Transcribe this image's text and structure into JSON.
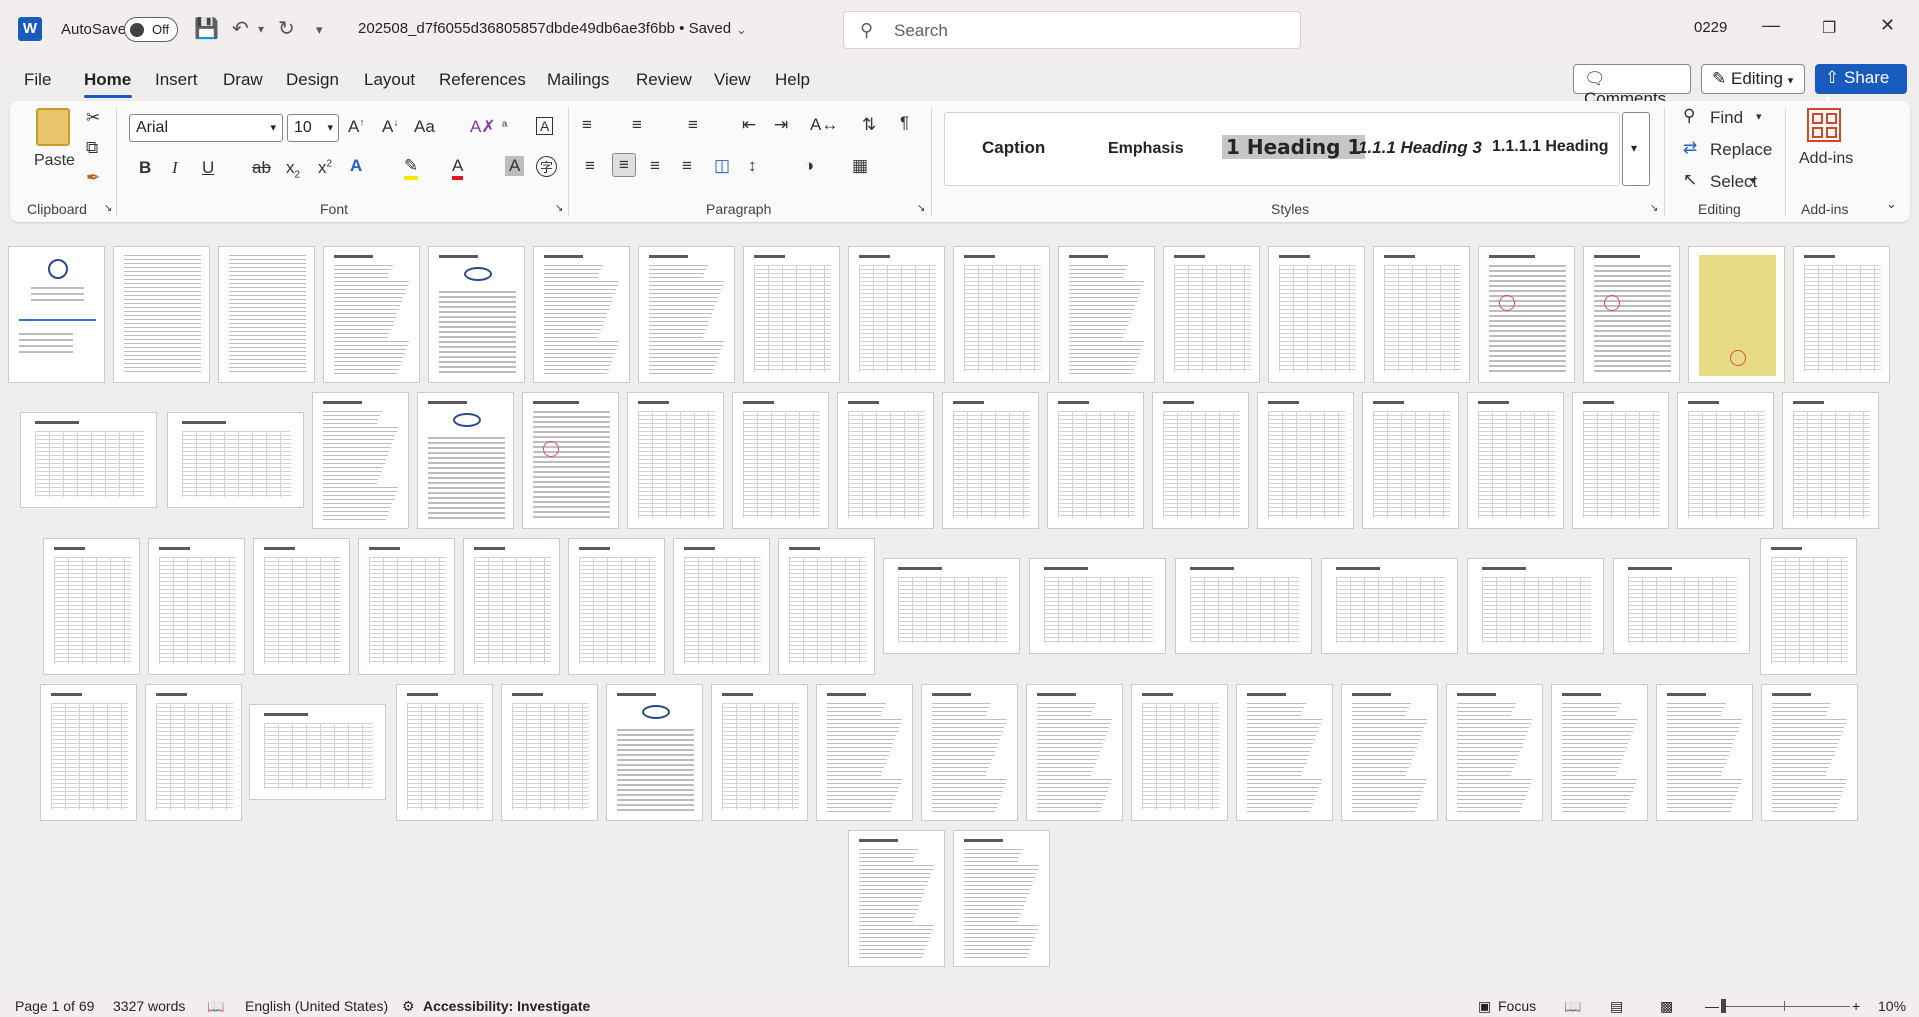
{
  "titlebar": {
    "app_icon": "word-icon",
    "autosave_label": "AutoSave",
    "autosave_state": "Off",
    "doc_title": "202508_d7f6055d36805857dbde49db6ae3f6bb • Saved",
    "search_placeholder": "Search",
    "user_id": "0229"
  },
  "tabs": [
    "File",
    "Home",
    "Insert",
    "Draw",
    "Design",
    "Layout",
    "References",
    "Mailings",
    "Review",
    "View",
    "Help"
  ],
  "right_actions": {
    "comments": "Comments",
    "editing": "Editing",
    "share": "Share"
  },
  "ribbon": {
    "clipboard": {
      "paste": "Paste",
      "label": "Clipboard"
    },
    "font": {
      "name": "Arial",
      "size": "10",
      "label": "Font",
      "case_btn": "Aa"
    },
    "paragraph": {
      "label": "Paragraph"
    },
    "styles": {
      "label": "Styles",
      "items": [
        "Caption",
        "Emphasis",
        "1 Heading 1",
        "1.1.1  Heading 3",
        "1.1.1.1  Heading"
      ]
    },
    "editing": {
      "label": "Editing",
      "find": "Find",
      "replace": "Replace",
      "select": "Select"
    },
    "addins": {
      "label": "Add-ins",
      "button": "Add-ins"
    }
  },
  "status": {
    "page": "Page 1 of 69",
    "words": "3327 words",
    "language": "English (United States)",
    "accessibility": "Accessibility: Investigate",
    "focus": "Focus",
    "zoom": "10%"
  }
}
